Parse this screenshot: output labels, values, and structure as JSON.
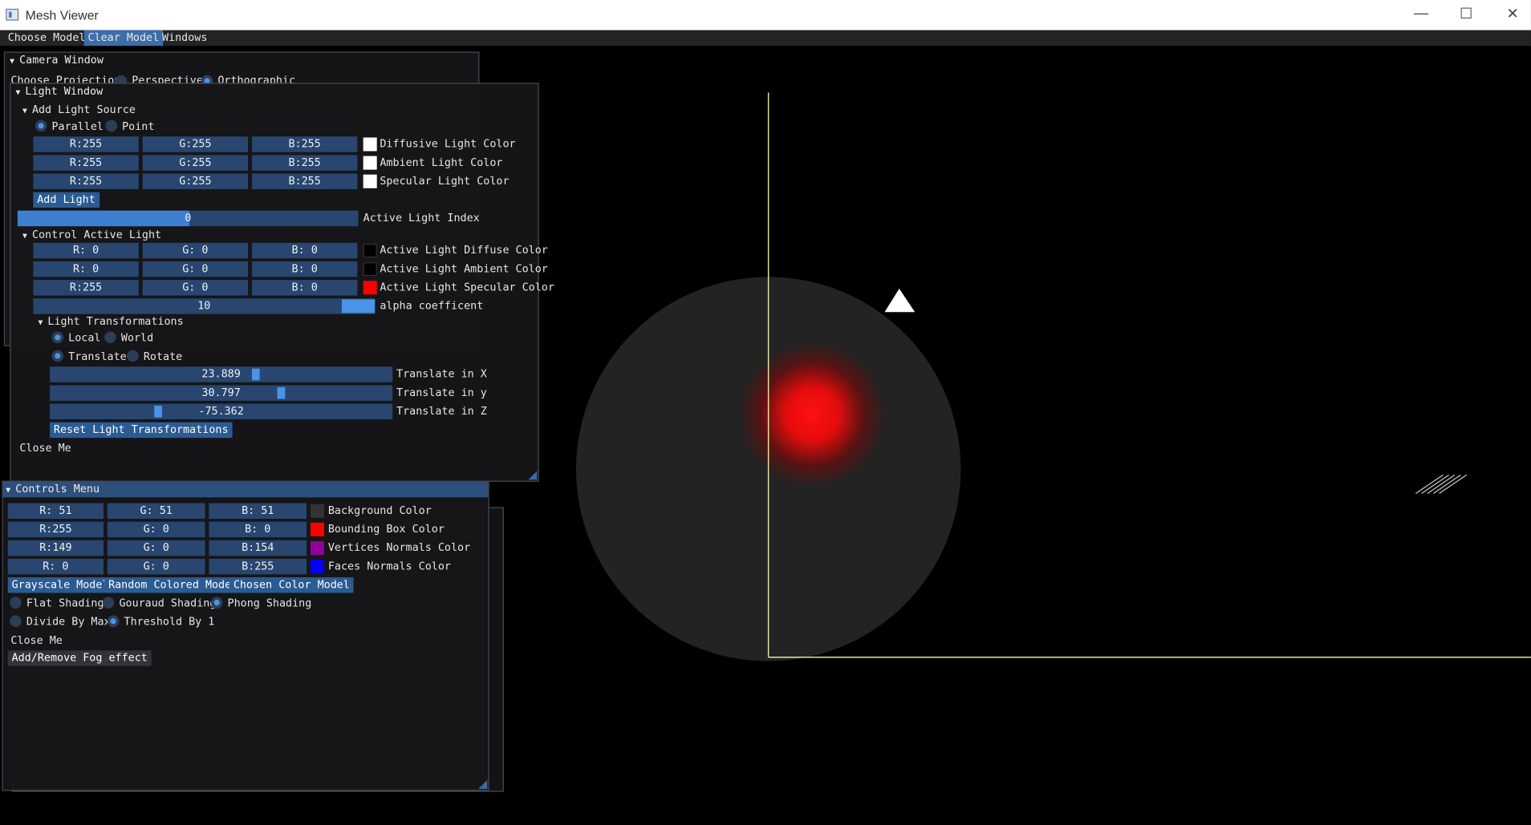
{
  "app": {
    "title": "Mesh Viewer"
  },
  "menu": {
    "items": [
      "Choose Model",
      "Clear Model",
      "Windows"
    ]
  },
  "camera_window": {
    "title": "Camera Window",
    "projection_label": "Choose Projection",
    "perspective": "Perspective",
    "orthographic": "Orthographic"
  },
  "light_window": {
    "title": "Light Window",
    "add_light_source": "Add Light Source",
    "parallel": "Parallel",
    "point": "Point",
    "rows": [
      {
        "r": "R:255",
        "g": "G:255",
        "b": "B:255",
        "label": "Diffusive Light Color",
        "color": "#ffffff"
      },
      {
        "r": "R:255",
        "g": "G:255",
        "b": "B:255",
        "label": "Ambient Light Color",
        "color": "#ffffff"
      },
      {
        "r": "R:255",
        "g": "G:255",
        "b": "B:255",
        "label": "Specular Light Color",
        "color": "#ffffff"
      }
    ],
    "add_light": "Add Light",
    "active_index_value": "0",
    "active_index_label": "Active Light Index",
    "control_active_light": "Control Active Light",
    "active_rows": [
      {
        "r": "R:  0",
        "g": "G:  0",
        "b": "B:  0",
        "label": "Active Light Diffuse Color",
        "color": "#000000"
      },
      {
        "r": "R:  0",
        "g": "G:  0",
        "b": "B:  0",
        "label": "Active Light Ambient Color",
        "color": "#000000"
      },
      {
        "r": "R:255",
        "g": "G:  0",
        "b": "B:  0",
        "label": "Active Light Specular Color",
        "color": "#ff0000"
      }
    ],
    "alpha_value": "10",
    "alpha_label": "alpha coefficent",
    "light_transformations": "Light Transformations",
    "local": "Local",
    "world": "World",
    "translate": "Translate",
    "rotate": "Rotate",
    "translates": [
      {
        "value": "23.889",
        "label": "Translate in X"
      },
      {
        "value": "30.797",
        "label": "Translate in y"
      },
      {
        "value": "-75.362",
        "label": "Translate in Z"
      }
    ],
    "reset": "Reset Light Transformations",
    "close": "Close Me"
  },
  "controls_menu": {
    "title": "Controls Menu",
    "rows": [
      {
        "r": "R: 51",
        "g": "G: 51",
        "b": "B: 51",
        "label": "Background Color",
        "color": "#333333"
      },
      {
        "r": "R:255",
        "g": "G:  0",
        "b": "B:  0",
        "label": "Bounding Box Color",
        "color": "#ff0000"
      },
      {
        "r": "R:149",
        "g": "G:  0",
        "b": "B:154",
        "label": "Vertices Normals Color",
        "color": "#95009a"
      },
      {
        "r": "R:  0",
        "g": "G:  0",
        "b": "B:255",
        "label": "Faces Normals Color",
        "color": "#0000ff"
      }
    ],
    "grayscale": "Grayscale Model",
    "random": "Random Colored Model",
    "chosen": "Chosen Color Model",
    "flat": "Flat Shading",
    "gouraud": "Gouraud Shading",
    "phong": "Phong Shading",
    "divide": "Divide By Max",
    "threshold": "Threshold By 1",
    "close": "Close Me",
    "fog": "Add/Remove Fog effect"
  },
  "window_controls": {
    "minimize": "—",
    "maximize": "☐",
    "close": "✕"
  },
  "colors": {
    "accent": "#4a93e6",
    "field": "#28466f",
    "button": "#2b5b93",
    "axis": "#e8e4a0"
  }
}
